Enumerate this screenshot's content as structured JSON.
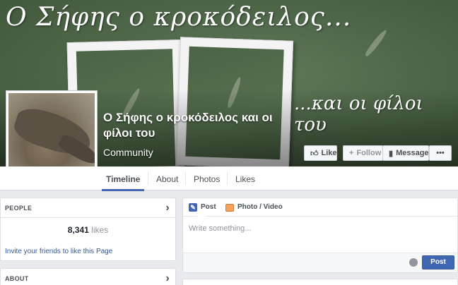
{
  "cover": {
    "title_top": "Ο Σήφης ο κροκόδειλος...",
    "title_bottom": "...και οι φίλοι του"
  },
  "page": {
    "name": "Ο Σήφης ο κροκόδειλος και οι φίλοι του",
    "category": "Community"
  },
  "actions": {
    "like": "Like",
    "follow": "Follow",
    "message": "Message",
    "more": "•••"
  },
  "nav": {
    "tabs": [
      "Timeline",
      "About",
      "Photos",
      "Likes"
    ],
    "active": "Timeline"
  },
  "people": {
    "header": "PEOPLE",
    "likes_count": "8,341",
    "likes_suffix": "likes",
    "invite": "Invite your friends to like this Page"
  },
  "about": {
    "header": "ABOUT"
  },
  "composer": {
    "tab_post": "Post",
    "tab_photo": "Photo / Video",
    "placeholder": "Write something...",
    "post_button": "Post"
  },
  "colors": {
    "accent": "#4267b2",
    "link": "#365899"
  },
  "icons": {
    "like": "thumbs-up-icon",
    "follow": "plus-icon",
    "message": "message-icon",
    "post": "pencil-icon",
    "photo": "photo-icon",
    "audience": "globe-icon"
  }
}
